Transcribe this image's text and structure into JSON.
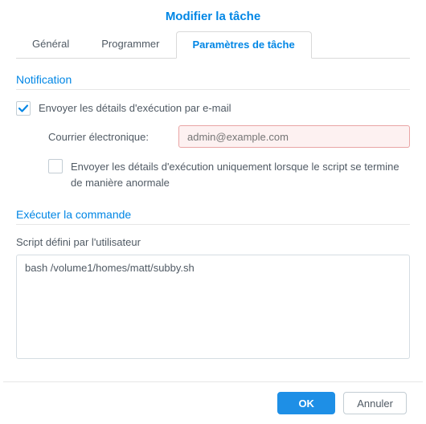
{
  "title": "Modifier la tâche",
  "tabs": {
    "general": "Général",
    "schedule": "Programmer",
    "settings": "Paramètres de tâche"
  },
  "notification": {
    "section_title": "Notification",
    "send_details_label": "Envoyer les détails d'exécution par e-mail",
    "email_label": "Courrier électronique:",
    "email_placeholder": "admin@example.com",
    "email_value": "",
    "only_on_error_label": "Envoyer les détails d'exécution uniquement lorsque le script se termine de manière anormale"
  },
  "run_command": {
    "section_title": "Exécuter la commande",
    "user_script_label": "Script défini par l'utilisateur",
    "script_value": "bash /volume1/homes/matt/subby.sh"
  },
  "buttons": {
    "ok": "OK",
    "cancel": "Annuler"
  }
}
